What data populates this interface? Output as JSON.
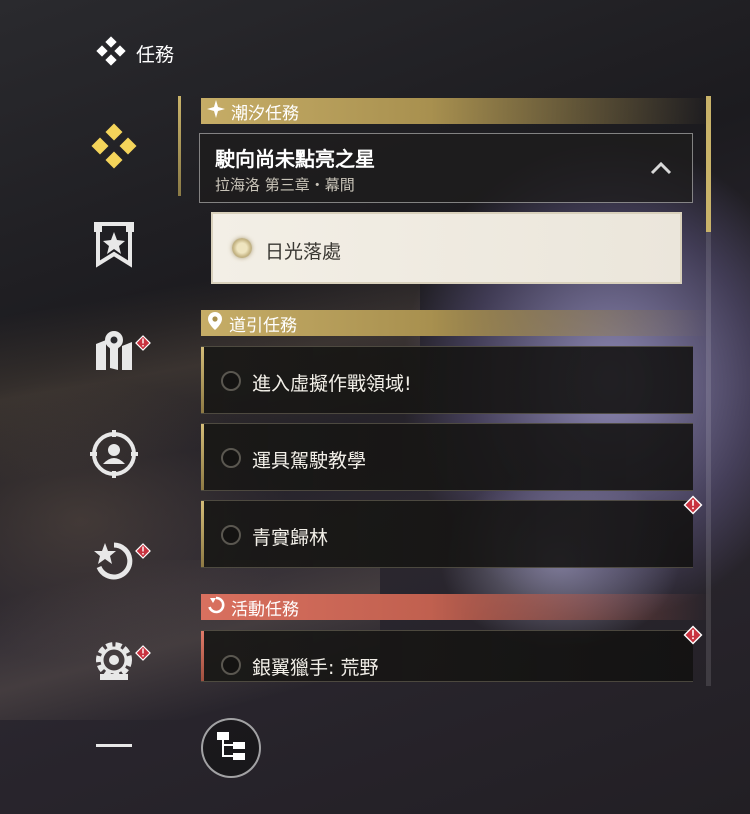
{
  "header": {
    "title": "任務",
    "icon": "four-diamond-icon"
  },
  "sidebar": {
    "items": [
      {
        "icon": "four-diamond-icon",
        "active": true,
        "badge": false
      },
      {
        "icon": "banner-star-icon",
        "active": false,
        "badge": false
      },
      {
        "icon": "map-pin-icon",
        "active": false,
        "badge": true
      },
      {
        "icon": "person-target-icon",
        "active": false,
        "badge": false
      },
      {
        "icon": "star-refresh-icon",
        "active": false,
        "badge": true
      },
      {
        "icon": "gear-camera-icon",
        "active": false,
        "badge": true
      }
    ]
  },
  "sections": {
    "tide": {
      "label": "潮汐任務",
      "icon": "sparkle-icon",
      "color": "#c6ad67"
    },
    "guide": {
      "label": "道引任務",
      "icon": "location-pin-icon",
      "color": "#c6ad67"
    },
    "event": {
      "label": "活動任務",
      "icon": "refresh-icon",
      "color": "#d9705f"
    }
  },
  "tide_quest": {
    "title": "駛向尚未點亮之星",
    "subtitle": "拉海洛 第三章・幕間",
    "step": "日光落處"
  },
  "guide_quests": [
    {
      "label": "進入虛擬作戰領域!",
      "alert": false
    },
    {
      "label": "運具駕駛教學",
      "alert": false
    },
    {
      "label": "青實歸林",
      "alert": true
    }
  ],
  "event_quests": [
    {
      "label": "銀翼獵手:  荒野",
      "alert": true
    }
  ],
  "colors": {
    "gold": "#c9b36a",
    "alert_red": "#c8323f"
  }
}
